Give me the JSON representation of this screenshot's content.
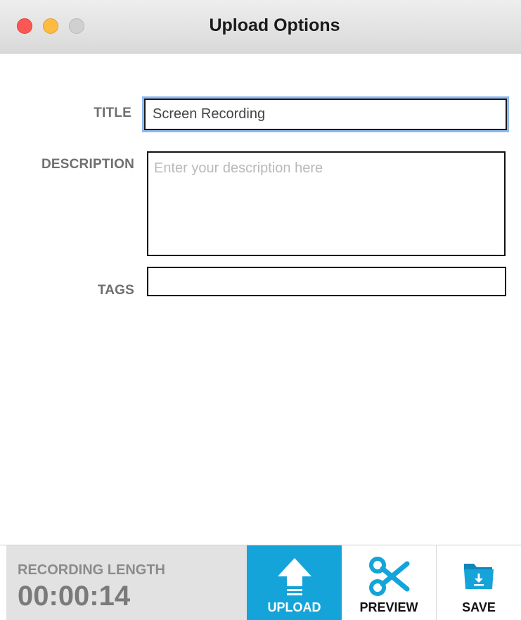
{
  "window": {
    "title": "Upload Options"
  },
  "form": {
    "title_label": "TITLE",
    "title_value": "Screen Recording",
    "description_label": "DESCRIPTION",
    "description_value": "",
    "description_placeholder": "Enter your description here",
    "tags_label": "TAGS",
    "tags_value": ""
  },
  "footer": {
    "recording_label": "RECORDING LENGTH",
    "recording_time": "00:00:14",
    "upload_label": "UPLOAD",
    "preview_label": "PREVIEW",
    "save_label": "SAVE"
  },
  "icons": {
    "upload": "upload-arrow-icon",
    "preview": "scissors-icon",
    "save": "folder-download-icon"
  },
  "colors": {
    "accent": "#15a4d9",
    "focus_ring": "#8fb9ef",
    "close": "#fc5753",
    "minimize": "#fdbc40",
    "zoom": "#d0d0d0",
    "recording_panel": "#e2e2e2"
  }
}
